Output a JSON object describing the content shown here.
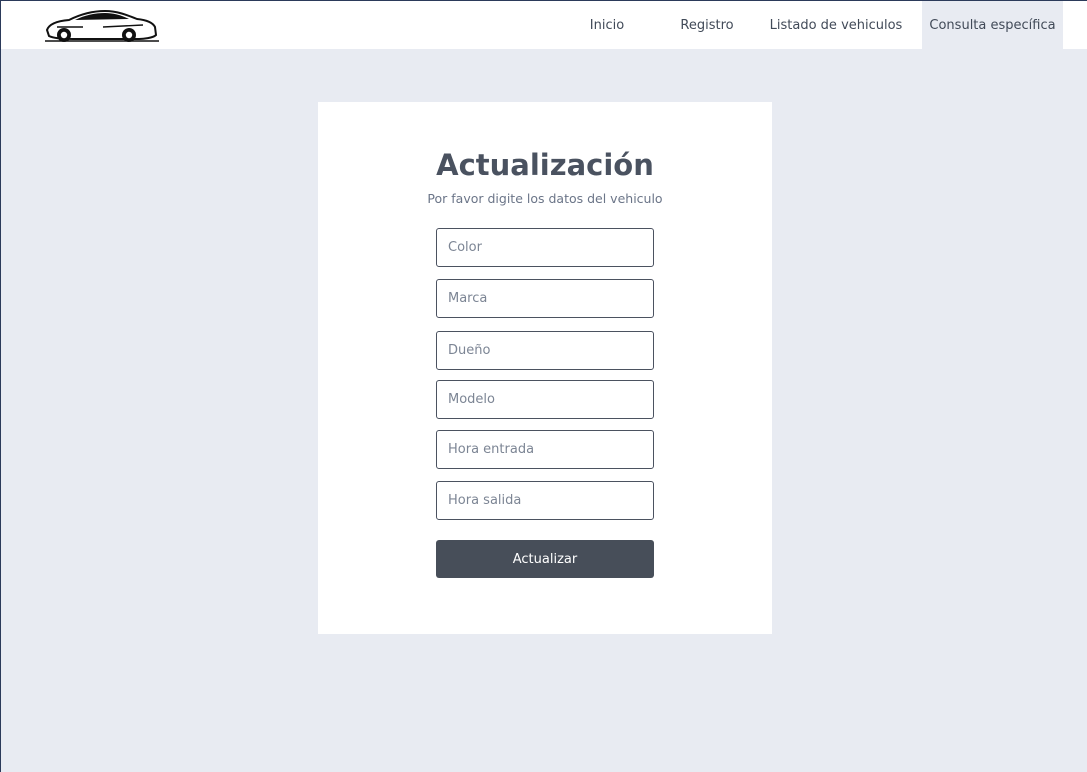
{
  "nav": {
    "logo_icon": "sports-car-icon",
    "links": [
      {
        "label": "Inicio"
      },
      {
        "label": "Registro"
      },
      {
        "label": "Listado de vehiculos"
      },
      {
        "label": "Consulta específica"
      }
    ],
    "active_link": "Consulta específica"
  },
  "form": {
    "title": "Actualización",
    "subtitle": "Por favor digite los datos del vehiculo",
    "fields": [
      {
        "placeholder": "Color",
        "value": ""
      },
      {
        "placeholder": "Marca",
        "value": ""
      },
      {
        "placeholder": "Dueño",
        "value": ""
      },
      {
        "placeholder": "Modelo",
        "value": ""
      },
      {
        "placeholder": "Hora entrada",
        "value": ""
      },
      {
        "placeholder": "Hora salida",
        "value": ""
      }
    ],
    "submit_label": "Actualizar"
  },
  "colors": {
    "background": "#e8ebf2",
    "button": "#474e59",
    "card": "#ffffff"
  }
}
